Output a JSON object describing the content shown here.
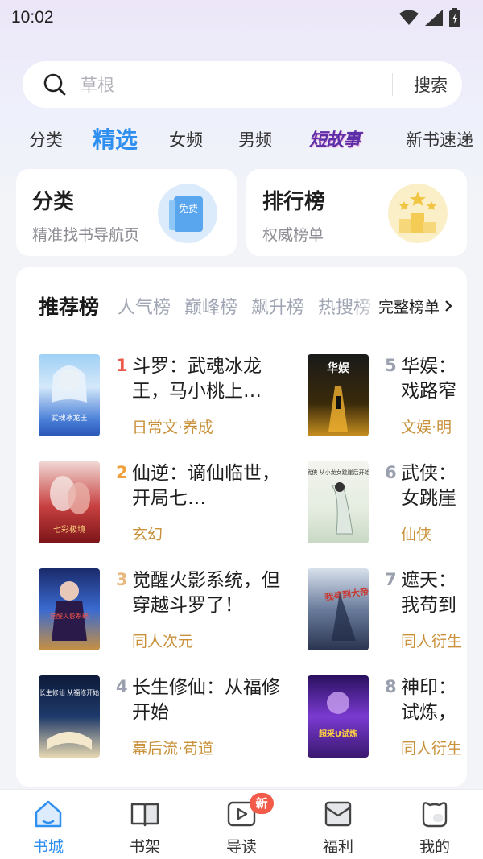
{
  "status_bar": {
    "time": "10:02"
  },
  "search": {
    "placeholder": "草根",
    "button_label": "搜索"
  },
  "tabs": [
    "分类",
    "精选",
    "女频",
    "男频",
    "短故事",
    "新书速递"
  ],
  "active_tab": "精选",
  "cards": [
    {
      "title": "分类",
      "subtitle": "精准找书导航页",
      "icon": "book-free-icon",
      "icon_text": "免费"
    },
    {
      "title": "排行榜",
      "subtitle": "权威榜单",
      "icon": "podium-icon",
      "icon_text": "213"
    }
  ],
  "rank": {
    "tabs": [
      "推荐榜",
      "人气榜",
      "巅峰榜",
      "飙升榜",
      "热搜榜"
    ],
    "more_label": "完整榜单",
    "books": [
      {
        "rank": "1",
        "title": "斗罗：武魂冰龙王，马小桃上…",
        "tag": "日常文·养成",
        "cover_text": "武魂冰龙王"
      },
      {
        "rank": "2",
        "title": "仙逆：谪仙临世，开局七…",
        "tag": "玄幻",
        "cover_text": "七彩极境"
      },
      {
        "rank": "3",
        "title": "觉醒火影系统，但穿越斗罗了！",
        "tag": "同人次元",
        "cover_text": "觉醒火影系统"
      },
      {
        "rank": "4",
        "title": "长生修仙：从福修开始",
        "tag": "幕后流·苟道",
        "cover_text": "长生修仙 从福修开始"
      },
      {
        "rank": "5",
        "title": "华娱：",
        "title2": "戏路窄",
        "tag": "文娱·明",
        "cover_text": "华娱"
      },
      {
        "rank": "6",
        "title": "武侠：",
        "title2": "女跳崖",
        "tag": "仙侠",
        "cover_text": "武侠 从小龙女跳崖后开始"
      },
      {
        "rank": "7",
        "title": "遮天：",
        "title2": "我苟到",
        "tag": "同人衍生",
        "cover_text": "我苟到大帝"
      },
      {
        "rank": "8",
        "title": "神印：",
        "title2": "试炼，",
        "tag": "同人衍生",
        "cover_text": "超采U试炼"
      }
    ]
  },
  "bottom_nav": [
    {
      "label": "书城",
      "icon": "home-icon",
      "active": true
    },
    {
      "label": "书架",
      "icon": "bookshelf-icon"
    },
    {
      "label": "导读",
      "icon": "play-icon",
      "badge": "新"
    },
    {
      "label": "福利",
      "icon": "gift-envelope-icon"
    },
    {
      "label": "我的",
      "icon": "profile-icon"
    }
  ],
  "colors": {
    "accent": "#2f8ff0",
    "tag": "#c8913a",
    "badge": "#f25a4a",
    "rank_top": "#ec5a4c",
    "rank_second": "#f0a03c",
    "rank_third": "#e8b880",
    "rank_other": "#9aa0ae"
  }
}
